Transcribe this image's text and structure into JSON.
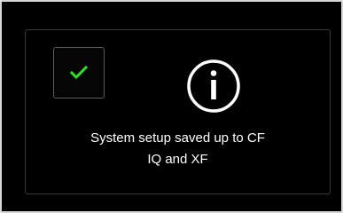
{
  "dialog": {
    "confirm_icon": "checkmark-icon",
    "status_icon": "info-icon",
    "message_lines": [
      "System setup saved up to CF",
      "IQ and XF"
    ]
  },
  "colors": {
    "background": "#000000",
    "checkmark": "#33e02b",
    "text": "#ffffff",
    "frame": "#d6d6d6"
  }
}
